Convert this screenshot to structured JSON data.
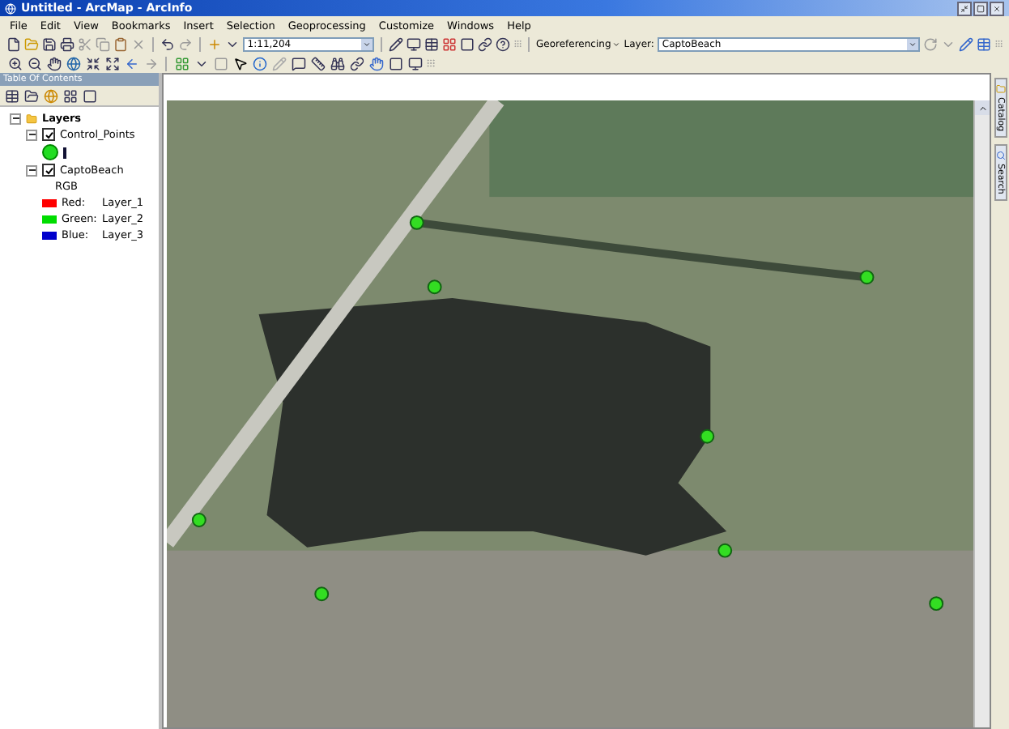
{
  "window": {
    "title": "Untitled - ArcMap - ArcInfo"
  },
  "menu": [
    "File",
    "Edit",
    "View",
    "Bookmarks",
    "Insert",
    "Selection",
    "Geoprocessing",
    "Customize",
    "Windows",
    "Help"
  ],
  "standard_toolbar": {
    "scale": "1:11,204"
  },
  "georeferencing_toolbar": {
    "menu": "Georeferencing",
    "layer_label": "Layer:",
    "layer": "CaptoBeach"
  },
  "toc": {
    "title": "Table Of Contents",
    "tree": [
      {
        "label": "Layers",
        "expanded": true,
        "children": [
          {
            "label": "Control_Points",
            "checked": true,
            "expanded": true,
            "legend": [
              {
                "kind": "point",
                "color": "#22dd22"
              }
            ]
          },
          {
            "label": "CaptoBeach",
            "checked": true,
            "expanded": true,
            "legend": [
              {
                "kind": "heading",
                "label": "RGB"
              },
              {
                "kind": "band",
                "color": "#ff0000",
                "label": "Red:",
                "value": "Layer_1"
              },
              {
                "kind": "band",
                "color": "#00dd00",
                "label": "Green:",
                "value": "Layer_2"
              },
              {
                "kind": "band",
                "color": "#0000cc",
                "label": "Blue:",
                "value": "Layer_3"
              }
            ]
          }
        ]
      }
    ]
  },
  "side_tabs": [
    {
      "label": "Catalog"
    },
    {
      "label": "Search"
    }
  ]
}
